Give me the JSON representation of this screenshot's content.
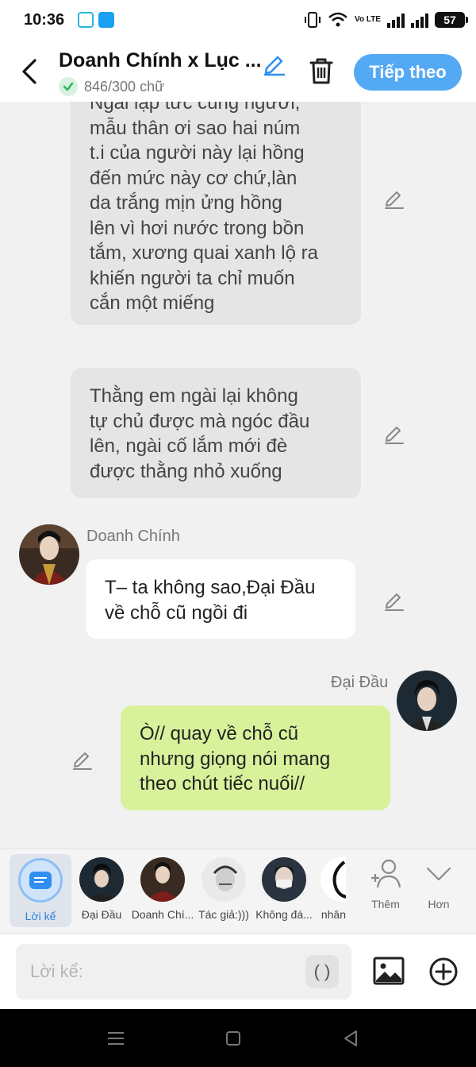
{
  "status": {
    "time": "10:36",
    "battery": "57",
    "volte": "Vo LTE"
  },
  "header": {
    "title": "Doanh Chính x Lục ...",
    "char_count": "846/300 chữ",
    "next_label": "Tiếp theo"
  },
  "messages": [
    {
      "type": "narration",
      "text": "Ngài lập tức cùng người,\nmẫu thân ơi sao hai núm\nt.i của người này lại hồng\nđến mức này cơ chứ,làn\nda trắng mịn ửng hồng\nlên vì hơi nước trong bồn\ntắm, xương quai xanh lộ ra\nkhiến người ta chỉ muốn\ncắn một miếng"
    },
    {
      "type": "narration",
      "text": "Thằng em ngài lại không\ntự chủ được mà ngóc đầu\nlên, ngài cố lắm mới đè\nđược thằng nhỏ xuống"
    },
    {
      "type": "left",
      "sender": "Doanh Chính",
      "text": "T– ta không sao,Đại Đầu\nvề chỗ cũ ngồi đi"
    },
    {
      "type": "right",
      "sender": "Đại Đầu",
      "text": "Ò// quay về chỗ cũ\nnhưng giọng nói mang\ntheo chút tiếc nuối//"
    }
  ],
  "characters": {
    "narrator_label": "Lời kể",
    "items": [
      {
        "name": "Đại Đầu"
      },
      {
        "name": "Doanh Chí..."
      },
      {
        "name": "Tác giả:)))"
      },
      {
        "name": "Không đá..."
      },
      {
        "name": "nhân"
      }
    ],
    "more_label": "Thêm",
    "expand_label": "Hơn"
  },
  "input": {
    "placeholder": "Lời kể:",
    "paren": "( )"
  }
}
